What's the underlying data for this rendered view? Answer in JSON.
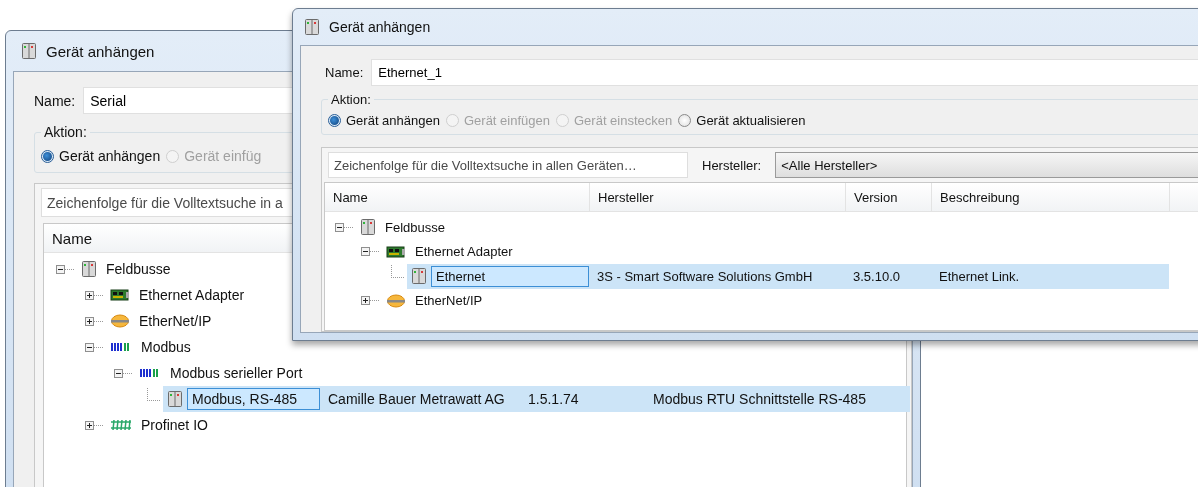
{
  "windows": [
    {
      "title": "Gerät anhängen",
      "name_label": "Name:",
      "name_value": "Serial",
      "action_label": "Aktion:",
      "actions": [
        {
          "label": "Gerät anhängen",
          "selected": true,
          "disabled": false
        },
        {
          "label": "Gerät einfüg",
          "selected": false,
          "disabled": true
        }
      ],
      "search": {
        "placeholder": "Zeichenfolge für die Volltextsuche in a"
      },
      "columns": [
        "Name"
      ],
      "tree": [
        {
          "label": "Feldbusse",
          "kind": "device",
          "expanded": true,
          "selected": false,
          "children": [
            {
              "label": "Ethernet Adapter",
              "kind": "adapter",
              "expanded": false,
              "selected": false
            },
            {
              "label": "EtherNet/IP",
              "kind": "ethernetip",
              "expanded": false,
              "selected": false
            },
            {
              "label": "Modbus",
              "kind": "modbus",
              "expanded": true,
              "selected": false,
              "children": [
                {
                  "label": "Modbus serieller Port",
                  "kind": "modbus",
                  "expanded": true,
                  "selected": false,
                  "children": [
                    {
                      "label": "Modbus, RS-485",
                      "kind": "device",
                      "selected": true,
                      "vendor": "Camille Bauer Metrawatt AG",
                      "version": "1.5.1.74",
                      "description": "Modbus RTU Schnittstelle RS-485"
                    }
                  ]
                }
              ]
            },
            {
              "label": "Profinet IO",
              "kind": "profinet",
              "expanded": false,
              "selected": false
            }
          ]
        }
      ]
    },
    {
      "title": "Gerät anhängen",
      "name_label": "Name:",
      "name_value": "Ethernet_1",
      "action_label": "Aktion:",
      "actions": [
        {
          "label": "Gerät anhängen",
          "selected": true,
          "disabled": false
        },
        {
          "label": "Gerät einfügen",
          "selected": false,
          "disabled": true
        },
        {
          "label": "Gerät einstecken",
          "selected": false,
          "disabled": true
        },
        {
          "label": "Gerät aktualisieren",
          "selected": false,
          "disabled": false
        }
      ],
      "search": {
        "placeholder": "Zeichenfolge für die Volltextsuche in allen Geräten…"
      },
      "vendor_filter": {
        "label": "Hersteller:",
        "value": "<Alle Hersteller>"
      },
      "columns": [
        "Name",
        "Hersteller",
        "Version",
        "Beschreibung"
      ],
      "tree": [
        {
          "label": "Feldbusse",
          "kind": "device",
          "expanded": true,
          "selected": false,
          "children": [
            {
              "label": "Ethernet Adapter",
              "kind": "adapter",
              "expanded": true,
              "selected": false,
              "children": [
                {
                  "label": "Ethernet",
                  "kind": "device",
                  "selected": true,
                  "vendor": "3S - Smart Software Solutions GmbH",
                  "version": "3.5.10.0",
                  "description": "Ethernet Link."
                }
              ]
            },
            {
              "label": "EtherNet/IP",
              "kind": "ethernetip",
              "expanded": false,
              "selected": false
            }
          ]
        }
      ]
    }
  ]
}
